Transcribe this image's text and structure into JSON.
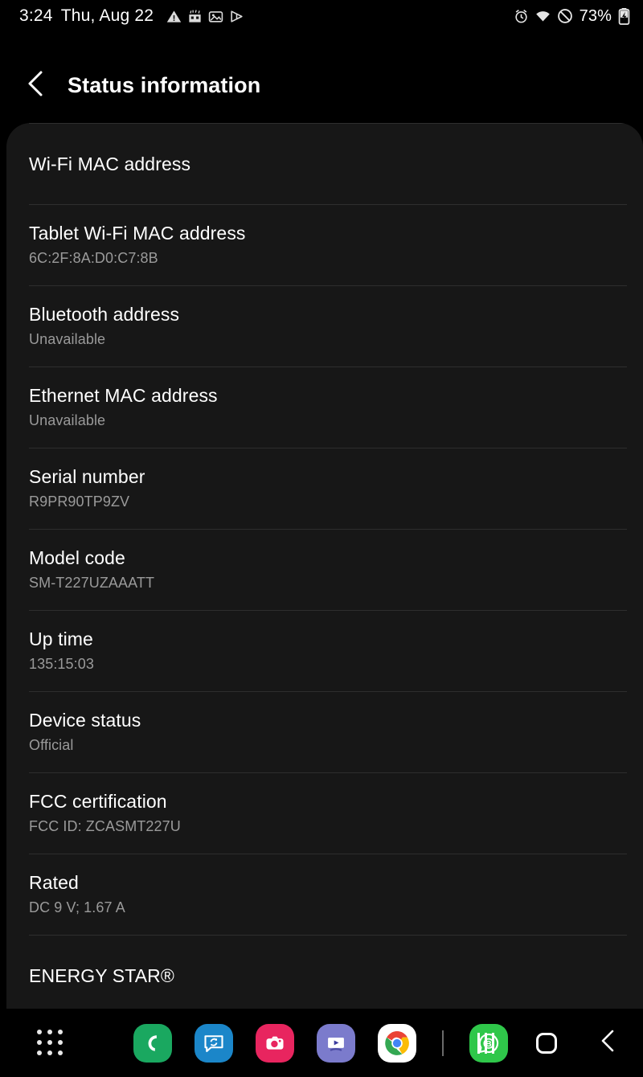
{
  "statusbar": {
    "time": "3:24",
    "date": "Thu, Aug 22",
    "battery_percent": "73%",
    "left_icons": [
      "warning-triangle-icon",
      "confetti-icon",
      "gallery-image-icon",
      "play-triangle-icon"
    ],
    "right_icons": [
      "alarm-clock-icon",
      "wifi-icon",
      "do-not-disturb-icon",
      "battery-charging-icon"
    ]
  },
  "header": {
    "back_icon": "chevron-left-icon",
    "title": "Status information"
  },
  "list": {
    "rows": [
      {
        "title": "Wi-Fi MAC address",
        "value": ""
      },
      {
        "title": "Tablet Wi-Fi MAC address",
        "value": "6C:2F:8A:D0:C7:8B"
      },
      {
        "title": "Bluetooth address",
        "value": "Unavailable"
      },
      {
        "title": "Ethernet MAC address",
        "value": "Unavailable"
      },
      {
        "title": "Serial number",
        "value": "R9PR90TP9ZV"
      },
      {
        "title": "Model code",
        "value": "SM-T227UZAAATT"
      },
      {
        "title": "Up time",
        "value": "135:15:03"
      },
      {
        "title": "Device status",
        "value": "Official"
      },
      {
        "title": "FCC certification",
        "value": "FCC ID: ZCASMT227U"
      },
      {
        "title": "Rated",
        "value": "DC 9 V; 1.67 A"
      },
      {
        "title": "ENERGY STAR®",
        "value": ""
      }
    ]
  },
  "taskbar": {
    "drawer_icon": "app-drawer-icon",
    "apps": [
      {
        "name": "phone-app-icon",
        "color": "#1aa860"
      },
      {
        "name": "messages-app-icon",
        "color": "#1b86c9"
      },
      {
        "name": "camera-app-icon",
        "color": "#e8255f"
      },
      {
        "name": "video-player-app-icon",
        "color": "#7b7bcc"
      },
      {
        "name": "chrome-app-icon",
        "color": "#ffffff"
      },
      {
        "name": "whatsapp-business-app-icon",
        "color": "#2fc74a"
      }
    ],
    "nav": [
      {
        "name": "recents-button",
        "icon": "three-bars-icon"
      },
      {
        "name": "home-button",
        "icon": "square-icon"
      },
      {
        "name": "back-button",
        "icon": "chevron-left-icon"
      }
    ]
  },
  "colors": {
    "background": "#000000",
    "card": "#171717",
    "divider": "#2e2e2e",
    "title_text": "#ffffff",
    "value_text": "#9a9a9a"
  }
}
